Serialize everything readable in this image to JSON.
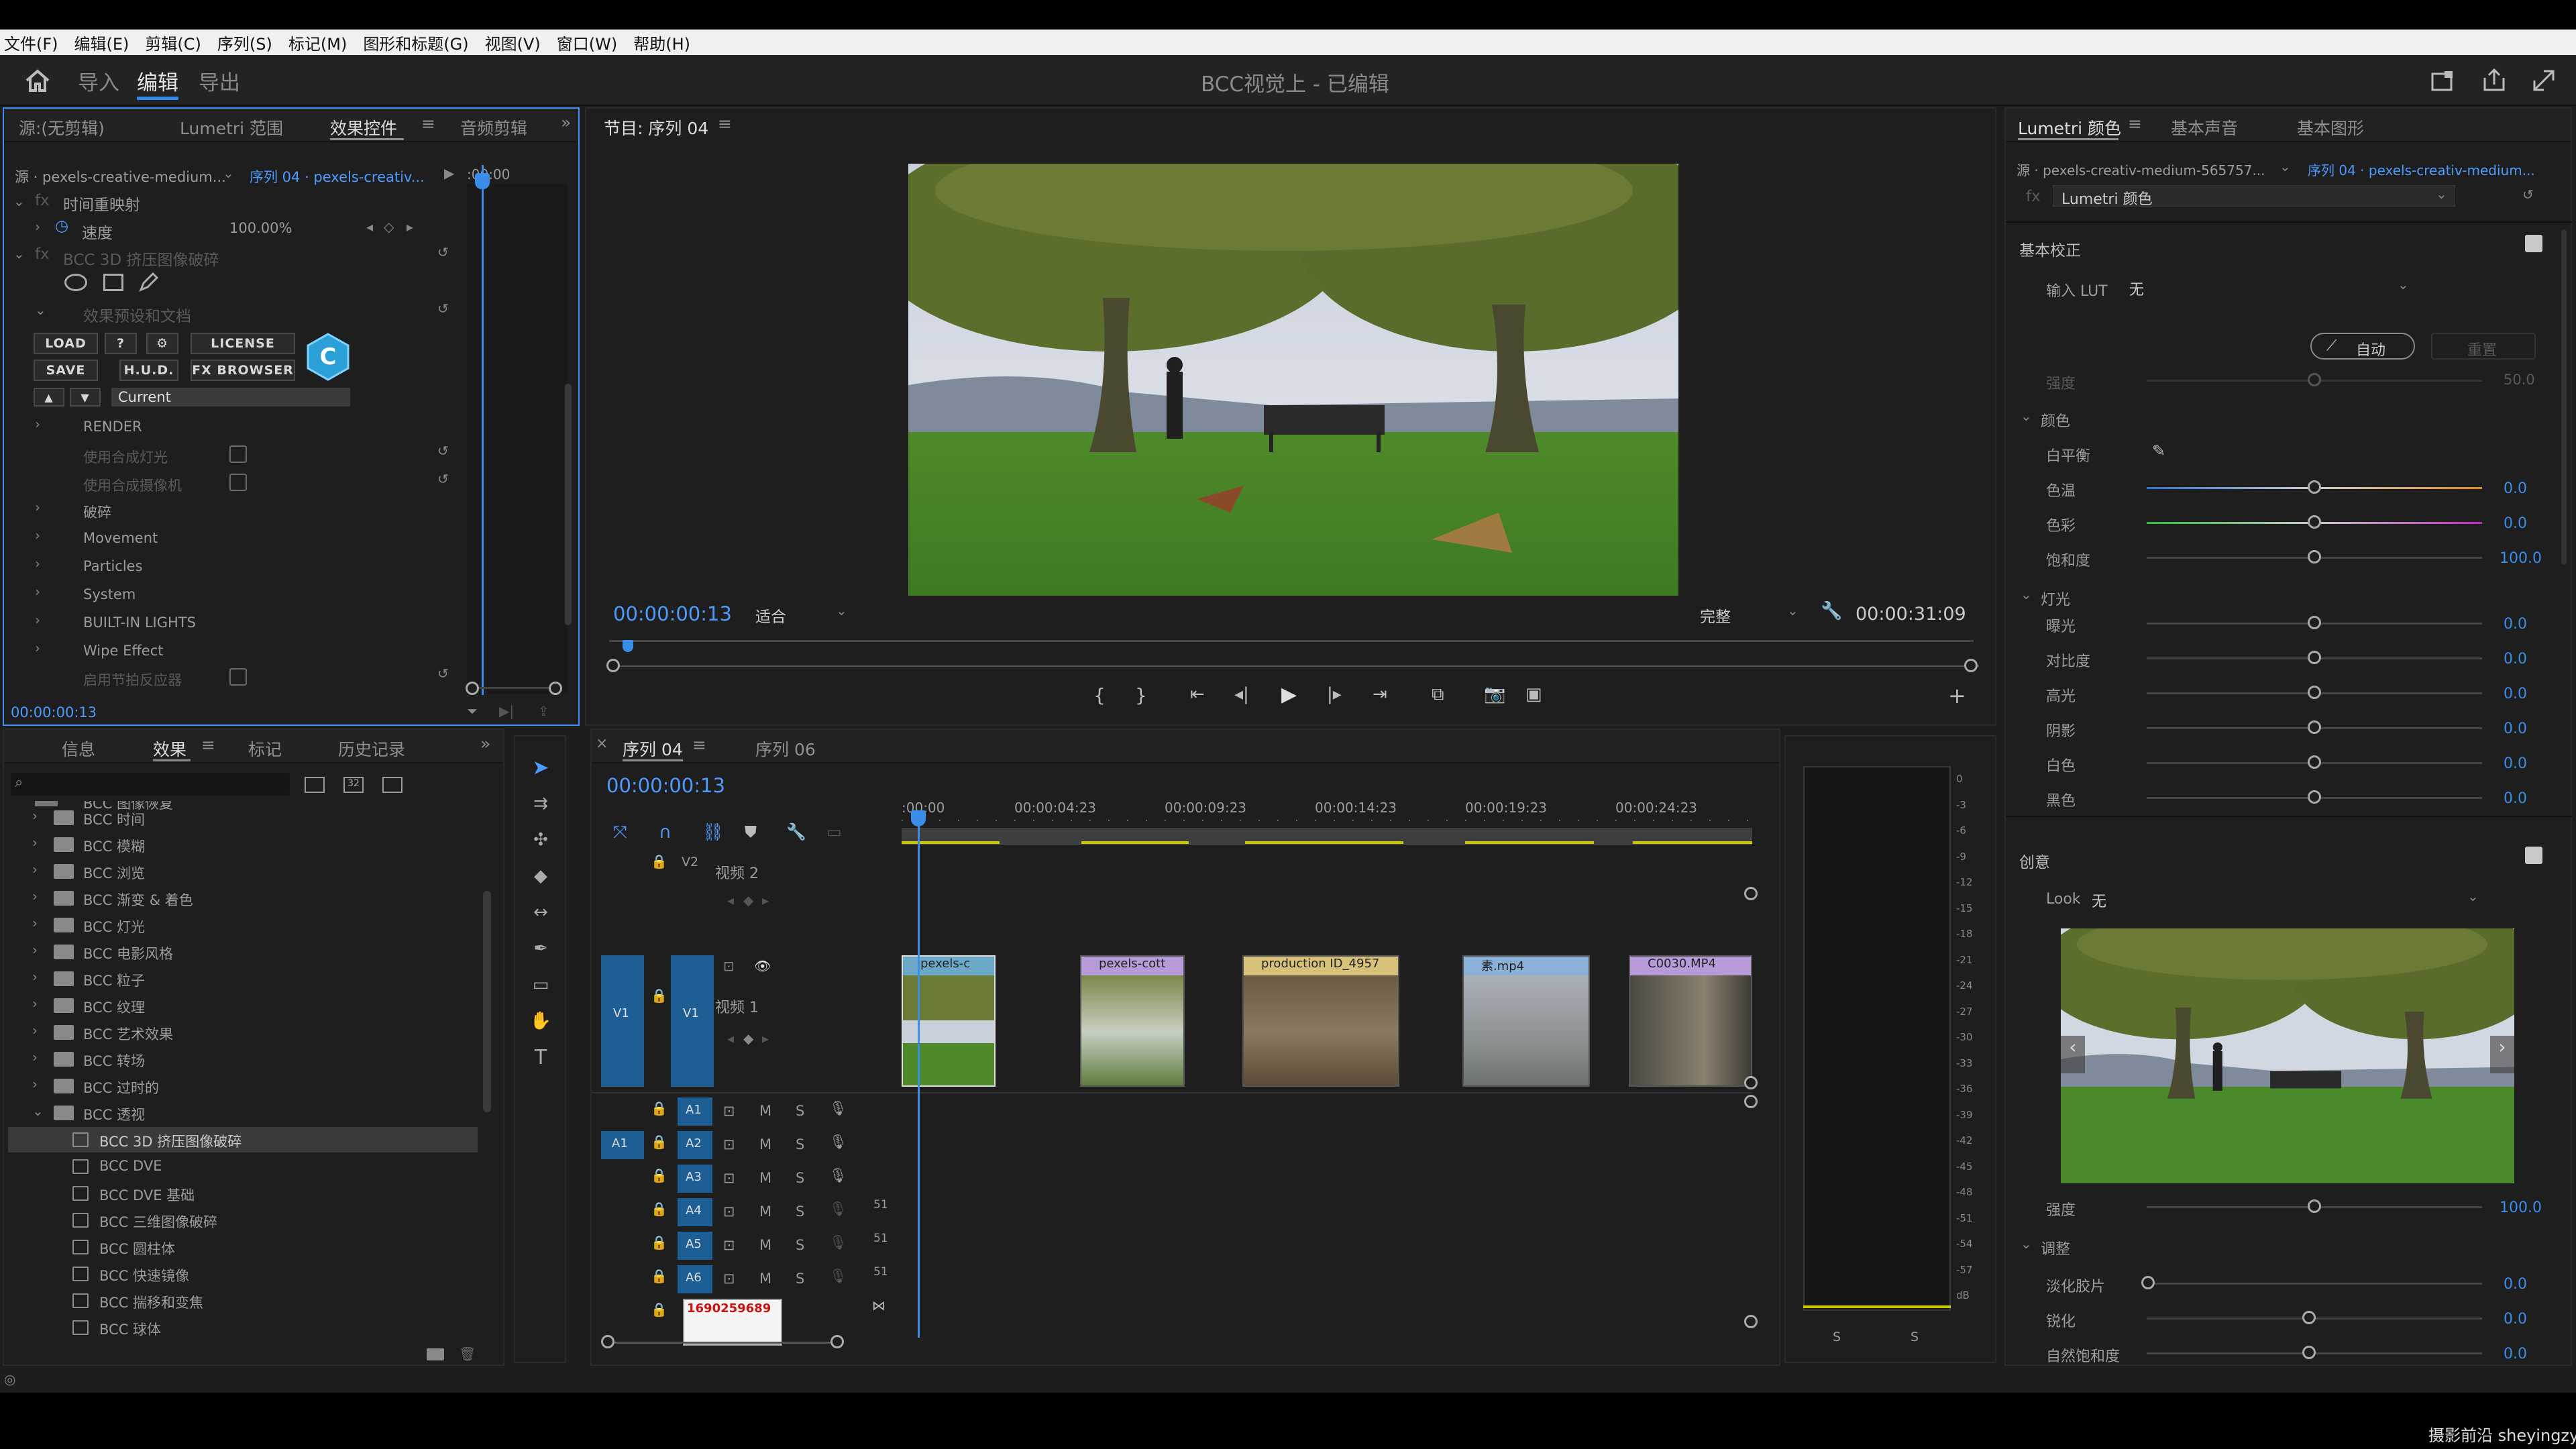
{
  "menubar": [
    "文件(F)",
    "编辑(E)",
    "剪辑(C)",
    "序列(S)",
    "标记(M)",
    "图形和标题(G)",
    "视图(V)",
    "窗口(W)",
    "帮助(H)"
  ],
  "workspace": {
    "tabs": [
      "导入",
      "编辑",
      "导出"
    ],
    "active": "编辑",
    "title": "BCC视觉上 - 已编辑"
  },
  "effect_controls": {
    "tabs": [
      "源:(无剪辑)",
      "Lumetri 范围",
      "效果控件",
      "音频剪辑"
    ],
    "active_tab": "效果控件",
    "source_clip": "源 · pexels-creative-medium...",
    "sequence_clip": "序列 04 · pexels-creativ...",
    "ruler_time": ":00:00",
    "time_remap": "时间重映射",
    "speed_label": "速度",
    "speed_value": "100.00%",
    "effect_name": "BCC 3D 挤压图像破碎",
    "presets_label": "效果预设和文档",
    "buttons": {
      "load": "LOAD",
      "help": "?",
      "gear": "⚙",
      "license": "LICENSE",
      "save": "SAVE",
      "hud": "H.U.D.",
      "fx_browser": "FX BROWSER"
    },
    "preset_current": "Current",
    "logo_letter": "C",
    "params": [
      "RENDER",
      "使用合成灯光",
      "使用合成摄像机",
      "破碎",
      "Movement",
      "Particles",
      "System",
      "BUILT-IN LIGHTS",
      "Wipe Effect",
      "启用节拍反应器"
    ],
    "timecode": "00:00:00:13"
  },
  "effects_panel": {
    "tabs": [
      "信息",
      "效果",
      "标记",
      "历史记录"
    ],
    "active_tab": "效果",
    "folders": [
      "BCC 时间",
      "BCC 模糊",
      "BCC 浏览",
      "BCC 渐变 & 着色",
      "BCC 灯光",
      "BCC 电影风格",
      "BCC 粒子",
      "BCC 纹理",
      "BCC 艺术效果",
      "BCC 转场",
      "BCC 过时的",
      "BCC 透视"
    ],
    "items": [
      "BCC 3D 挤压图像破碎",
      "BCC DVE",
      "BCC DVE 基础",
      "BCC 三维图像破碎",
      "BCC 圆柱体",
      "BCC 快速镜像",
      "BCC 揣移和变焦",
      "BCC 球体"
    ],
    "selected_item": "BCC 3D 挤压图像破碎"
  },
  "program_monitor": {
    "tab": "节目: 序列 04",
    "timecode": "00:00:00:13",
    "fit": "适合",
    "quality": "完整",
    "duration": "00:00:31:09"
  },
  "timeline": {
    "tabs": [
      "序列 04",
      "序列 06"
    ],
    "active_tab": "序列 04",
    "timecode": "00:00:00:13",
    "ruler": [
      ":00:00",
      "00:00:04:23",
      "00:00:09:23",
      "00:00:14:23",
      "00:00:19:23",
      "00:00:24:23"
    ],
    "video_tracks": [
      {
        "id": "V2",
        "name": "视频 2"
      },
      {
        "id": "V1",
        "name": "视频 1"
      }
    ],
    "audio_tracks": [
      "A1",
      "A2",
      "A3",
      "A4",
      "A5",
      "A6"
    ],
    "source_v": "V1",
    "source_a": "A1",
    "clips": [
      "pexels-c",
      "pexels-cott",
      "production ID_4957",
      "素.mp4",
      "C0030.MP4"
    ],
    "watermark_text": "1690259689",
    "meter_ticks": [
      "0",
      "-3",
      "-6",
      "-9",
      "-12",
      "-15",
      "-18",
      "-21",
      "-24",
      "-27",
      "-30",
      "-33",
      "-36",
      "-39",
      "-42",
      "-45",
      "-48",
      "-51",
      "-54",
      "-57",
      "dB"
    ],
    "meter_solo": [
      "S",
      "S"
    ]
  },
  "lumetri": {
    "tabs": [
      "Lumetri 颜色",
      "基本声音",
      "基本图形"
    ],
    "active_tab": "Lumetri 颜色",
    "source_clip": "源 · pexels-creativ-medium-565757...",
    "sequence_clip": "序列 04 · pexels-creativ-medium...",
    "effect_select": "Lumetri 颜色",
    "basic": {
      "title": "基本校正",
      "input_lut_label": "输入 LUT",
      "input_lut": "无",
      "auto": "自动",
      "reset": "重置",
      "intensity_label": "强度",
      "intensity_value": "50.0"
    },
    "color": {
      "title": "颜色",
      "wb": "白平衡",
      "temp": "色温",
      "temp_value": "0.0",
      "tint": "色彩",
      "tint_value": "0.0",
      "sat": "饱和度",
      "sat_value": "100.0"
    },
    "light": {
      "title": "灯光",
      "rows": [
        {
          "label": "曝光",
          "value": "0.0"
        },
        {
          "label": "对比度",
          "value": "0.0"
        },
        {
          "label": "高光",
          "value": "0.0"
        },
        {
          "label": "阴影",
          "value": "0.0"
        },
        {
          "label": "白色",
          "value": "0.0"
        },
        {
          "label": "黑色",
          "value": "0.0"
        }
      ]
    },
    "creative": {
      "title": "创意",
      "look_label": "Look",
      "look": "无",
      "intensity_label": "强度",
      "intensity_value": "100.0"
    },
    "adjust": {
      "title": "调整",
      "rows": [
        {
          "label": "淡化胶片",
          "value": "0.0"
        },
        {
          "label": "锐化",
          "value": "0.0"
        },
        {
          "label": "自然饱和度",
          "value": "0.0"
        }
      ]
    }
  },
  "watermark": "摄影前沿 sheyingzy.com",
  "colors": {
    "accent": "#2d8ceb",
    "value_blue": "#3a8de8",
    "panel": "#1e1e1e"
  }
}
